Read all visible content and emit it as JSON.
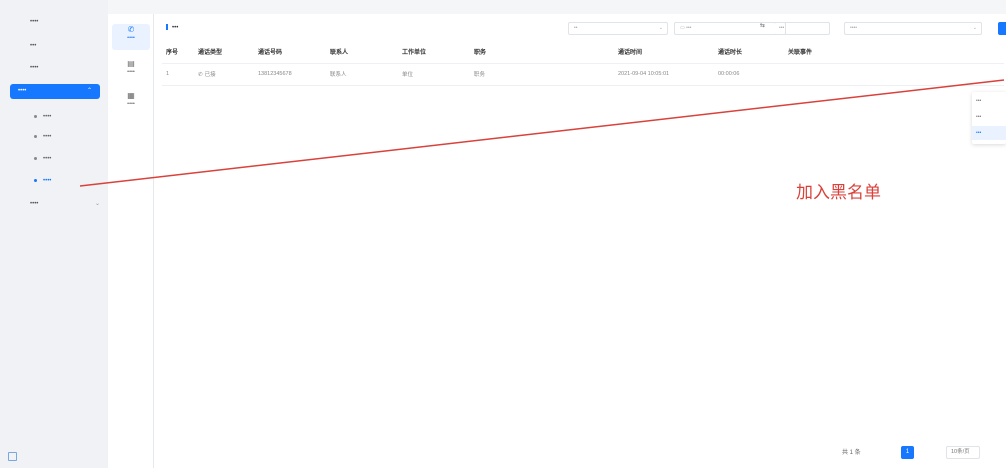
{
  "sidebar": {
    "items": [
      {
        "label": "••••",
        "active": false
      },
      {
        "label": "•••",
        "active": false
      },
      {
        "label": "••••",
        "active": false
      },
      {
        "label": "•••• ",
        "active": true
      },
      {
        "label": "••••",
        "active": false
      }
    ],
    "sub_items": [
      {
        "label": "••••",
        "current": false
      },
      {
        "label": "••••",
        "current": false
      },
      {
        "label": "••••",
        "current": false
      },
      {
        "label": "••••",
        "current": true
      }
    ]
  },
  "tools": [
    {
      "icon": "phone-icon",
      "label": "••••",
      "active": true
    },
    {
      "icon": "list-icon",
      "label": "••••",
      "active": false
    },
    {
      "icon": "doc-icon",
      "label": "••••",
      "active": false
    }
  ],
  "panel": {
    "title": "•••",
    "filters": {
      "type_placeholder": "••",
      "date_start": "•••",
      "date_end": "•••",
      "keyword_placeholder": "••••"
    }
  },
  "table": {
    "headers": [
      "序号",
      "通话类型",
      "通话号码",
      "联系人",
      "工作单位",
      "职务",
      "",
      "通话时间",
      "通话时长",
      "关联事件",
      ""
    ],
    "rows": [
      [
        "1",
        "已接",
        "13812345678",
        "联系人",
        "单位",
        "职务",
        "",
        "2021-09-04 10:05:01",
        "00:00:06",
        "",
        ""
      ]
    ]
  },
  "context_menu": [
    "•••",
    "•••",
    "•••"
  ],
  "annotation": "加入黑名单",
  "pagination": {
    "total": "共 1 条",
    "current_page": "1",
    "page_size": "10条/页"
  },
  "colors": {
    "accent": "#1677ff",
    "annotation": "#d9413b"
  }
}
